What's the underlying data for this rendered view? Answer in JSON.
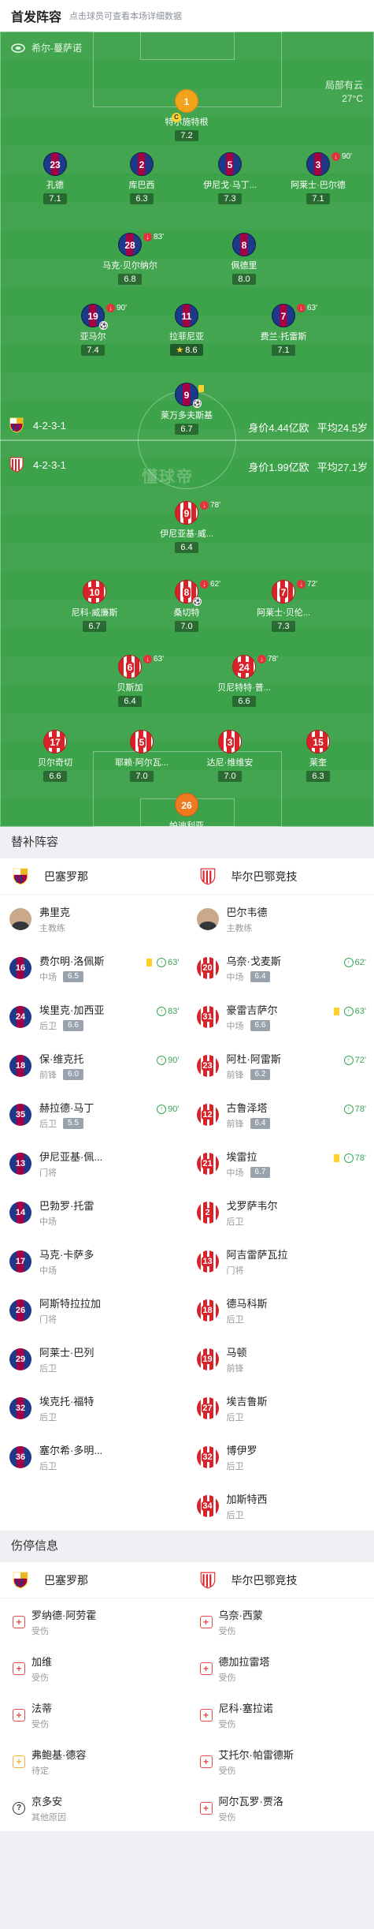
{
  "header": {
    "title": "首发阵容",
    "subtitle": "点击球员可查看本场详细数据"
  },
  "venue": {
    "name": "希尔-蔓萨诺",
    "weather": "局部有云",
    "temp": "27°C"
  },
  "home": {
    "formation": "4-2-3-1",
    "value": "身价4.44亿欧",
    "age": "平均24.5岁",
    "players": [
      {
        "num": "1",
        "name": "特尔施特根",
        "rating": "7.2",
        "kit": "gk1"
      },
      {
        "num": "23",
        "name": "孔德",
        "rating": "7.1",
        "kit": "bar"
      },
      {
        "num": "2",
        "name": "库巴西",
        "rating": "6.3",
        "kit": "bar"
      },
      {
        "num": "5",
        "name": "伊尼戈·马丁...",
        "rating": "7.3",
        "kit": "bar"
      },
      {
        "num": "3",
        "name": "阿莱士·巴尔德",
        "rating": "7.1",
        "kit": "bar",
        "sub": "90'"
      },
      {
        "num": "28",
        "name": "马克·贝尔纳尔",
        "rating": "6.8",
        "kit": "bar",
        "sub": "83'"
      },
      {
        "num": "8",
        "name": "佩德里",
        "rating": "8.0",
        "kit": "bar"
      },
      {
        "num": "19",
        "name": "亚马尔",
        "rating": "7.4",
        "kit": "bar",
        "sub": "90'"
      },
      {
        "num": "11",
        "name": "拉菲尼亚",
        "rating": "8.6",
        "kit": "bar"
      },
      {
        "num": "7",
        "name": "费兰·托雷斯",
        "rating": "7.1",
        "kit": "bar",
        "sub": "63'"
      },
      {
        "num": "9",
        "name": "莱万多夫斯基",
        "rating": "6.7",
        "kit": "bar"
      }
    ]
  },
  "away": {
    "formation": "4-2-3-1",
    "value": "身价1.99亿欧",
    "age": "平均27.1岁",
    "players": [
      {
        "num": "9",
        "name": "伊尼亚基·威...",
        "rating": "6.4",
        "kit": "ath",
        "sub": "78'"
      },
      {
        "num": "10",
        "name": "尼科·威廉斯",
        "rating": "6.7",
        "kit": "ath"
      },
      {
        "num": "8",
        "name": "桑切特",
        "rating": "7.0",
        "kit": "ath",
        "sub": "62'"
      },
      {
        "num": "7",
        "name": "阿莱士·贝伦...",
        "rating": "7.3",
        "kit": "ath",
        "sub": "72'"
      },
      {
        "num": "6",
        "name": "贝斯加",
        "rating": "6.4",
        "kit": "ath",
        "sub": "63'"
      },
      {
        "num": "24",
        "name": "贝尼特特·普...",
        "rating": "6.6",
        "kit": "ath",
        "sub": "78'"
      },
      {
        "num": "17",
        "name": "贝尔奇切",
        "rating": "6.6",
        "kit": "ath"
      },
      {
        "num": "5",
        "name": "耶赖·阿尔瓦...",
        "rating": "7.0",
        "kit": "ath"
      },
      {
        "num": "3",
        "name": "达尼·维维安",
        "rating": "7.0",
        "kit": "ath"
      },
      {
        "num": "15",
        "name": "莱奎",
        "rating": "6.3",
        "kit": "ath"
      },
      {
        "num": "26",
        "name": "帕迪利亚",
        "rating": "6.6",
        "kit": "gk2"
      }
    ]
  },
  "watermark": "懂球帝",
  "subs_title": "替补阵容",
  "teams": {
    "home": "巴塞罗那",
    "away": "毕尔巴鄂竞技"
  },
  "coaches": {
    "home": {
      "name": "弗里克",
      "role": "主教练"
    },
    "away": {
      "name": "巴尔韦德",
      "role": "主教练"
    }
  },
  "subs": [
    {
      "h": {
        "num": "16",
        "name": "费尔明·洛佩斯",
        "pos": "中场",
        "rating": "6.5",
        "card": true,
        "ev": "63'",
        "kit": "bar"
      },
      "a": {
        "num": "20",
        "name": "乌奈·戈麦斯",
        "pos": "中场",
        "rating": "6.4",
        "ev": "62'",
        "kit": "ath"
      }
    },
    {
      "h": {
        "num": "24",
        "name": "埃里克·加西亚",
        "pos": "后卫",
        "rating": "6.6",
        "ev": "83'",
        "kit": "bar"
      },
      "a": {
        "num": "31",
        "name": "豪雷吉萨尔",
        "pos": "中场",
        "rating": "6.6",
        "card": true,
        "ev": "63'",
        "kit": "ath"
      }
    },
    {
      "h": {
        "num": "18",
        "name": "保·维克托",
        "pos": "前锋",
        "rating": "6.0",
        "ev": "90'",
        "kit": "bar"
      },
      "a": {
        "num": "23",
        "name": "阿杜·阿雷斯",
        "pos": "前锋",
        "rating": "6.2",
        "ev": "72'",
        "kit": "ath"
      }
    },
    {
      "h": {
        "num": "35",
        "name": "赫拉德·马丁",
        "pos": "后卫",
        "rating": "5.5",
        "ev": "90'",
        "kit": "bar"
      },
      "a": {
        "num": "12",
        "name": "古鲁泽塔",
        "pos": "前锋",
        "rating": "6.4",
        "ev": "78'",
        "kit": "ath"
      }
    },
    {
      "h": {
        "num": "13",
        "name": "伊尼亚基·佩...",
        "pos": "门将",
        "kit": "bar"
      },
      "a": {
        "num": "21",
        "name": "埃雷拉",
        "pos": "中场",
        "rating": "6.7",
        "card": true,
        "ev": "78'",
        "kit": "ath"
      }
    },
    {
      "h": {
        "num": "14",
        "name": "巴勃罗·托雷",
        "pos": "中场",
        "kit": "bar"
      },
      "a": {
        "num": "2",
        "name": "戈罗萨韦尔",
        "pos": "后卫",
        "kit": "ath"
      }
    },
    {
      "h": {
        "num": "17",
        "name": "马克·卡萨多",
        "pos": "中场",
        "kit": "bar"
      },
      "a": {
        "num": "13",
        "name": "阿吉雷萨瓦拉",
        "pos": "门将",
        "kit": "ath"
      }
    },
    {
      "h": {
        "num": "26",
        "name": "阿斯特拉拉加",
        "pos": "门将",
        "kit": "bar"
      },
      "a": {
        "num": "18",
        "name": "德马科斯",
        "pos": "后卫",
        "kit": "ath"
      }
    },
    {
      "h": {
        "num": "29",
        "name": "阿莱士·巴列",
        "pos": "后卫",
        "kit": "bar"
      },
      "a": {
        "num": "19",
        "name": "马顿",
        "pos": "前锋",
        "kit": "ath"
      }
    },
    {
      "h": {
        "num": "32",
        "name": "埃克托·福特",
        "pos": "后卫",
        "kit": "bar"
      },
      "a": {
        "num": "27",
        "name": "埃吉鲁斯",
        "pos": "后卫",
        "kit": "ath"
      }
    },
    {
      "h": {
        "num": "36",
        "name": "塞尔希·多明...",
        "pos": "后卫",
        "kit": "bar"
      },
      "a": {
        "num": "32",
        "name": "博伊罗",
        "pos": "后卫",
        "kit": "ath"
      }
    },
    {
      "h": null,
      "a": {
        "num": "34",
        "name": "加斯特西",
        "pos": "后卫",
        "kit": "ath"
      }
    }
  ],
  "injury_title": "伤停信息",
  "injuries": [
    {
      "h": {
        "name": "罗纳德·阿劳霍",
        "status": "受伤",
        "type": "plus"
      },
      "a": {
        "name": "乌奈·西蒙",
        "status": "受伤",
        "type": "plus"
      }
    },
    {
      "h": {
        "name": "加维",
        "status": "受伤",
        "type": "plus"
      },
      "a": {
        "name": "德加拉雷塔",
        "status": "受伤",
        "type": "plus"
      }
    },
    {
      "h": {
        "name": "法蒂",
        "status": "受伤",
        "type": "plus"
      },
      "a": {
        "name": "尼科·塞拉诺",
        "status": "受伤",
        "type": "plus"
      }
    },
    {
      "h": {
        "name": "弗鲍基·德容",
        "status": "待定",
        "type": "pend"
      },
      "a": {
        "name": "艾托尔·帕雷德斯",
        "status": "受伤",
        "type": "plus"
      }
    },
    {
      "h": {
        "name": "京多安",
        "status": "其他原因",
        "type": "q"
      },
      "a": {
        "name": "阿尔瓦罗·贾洛",
        "status": "受伤",
        "type": "plus"
      }
    }
  ]
}
